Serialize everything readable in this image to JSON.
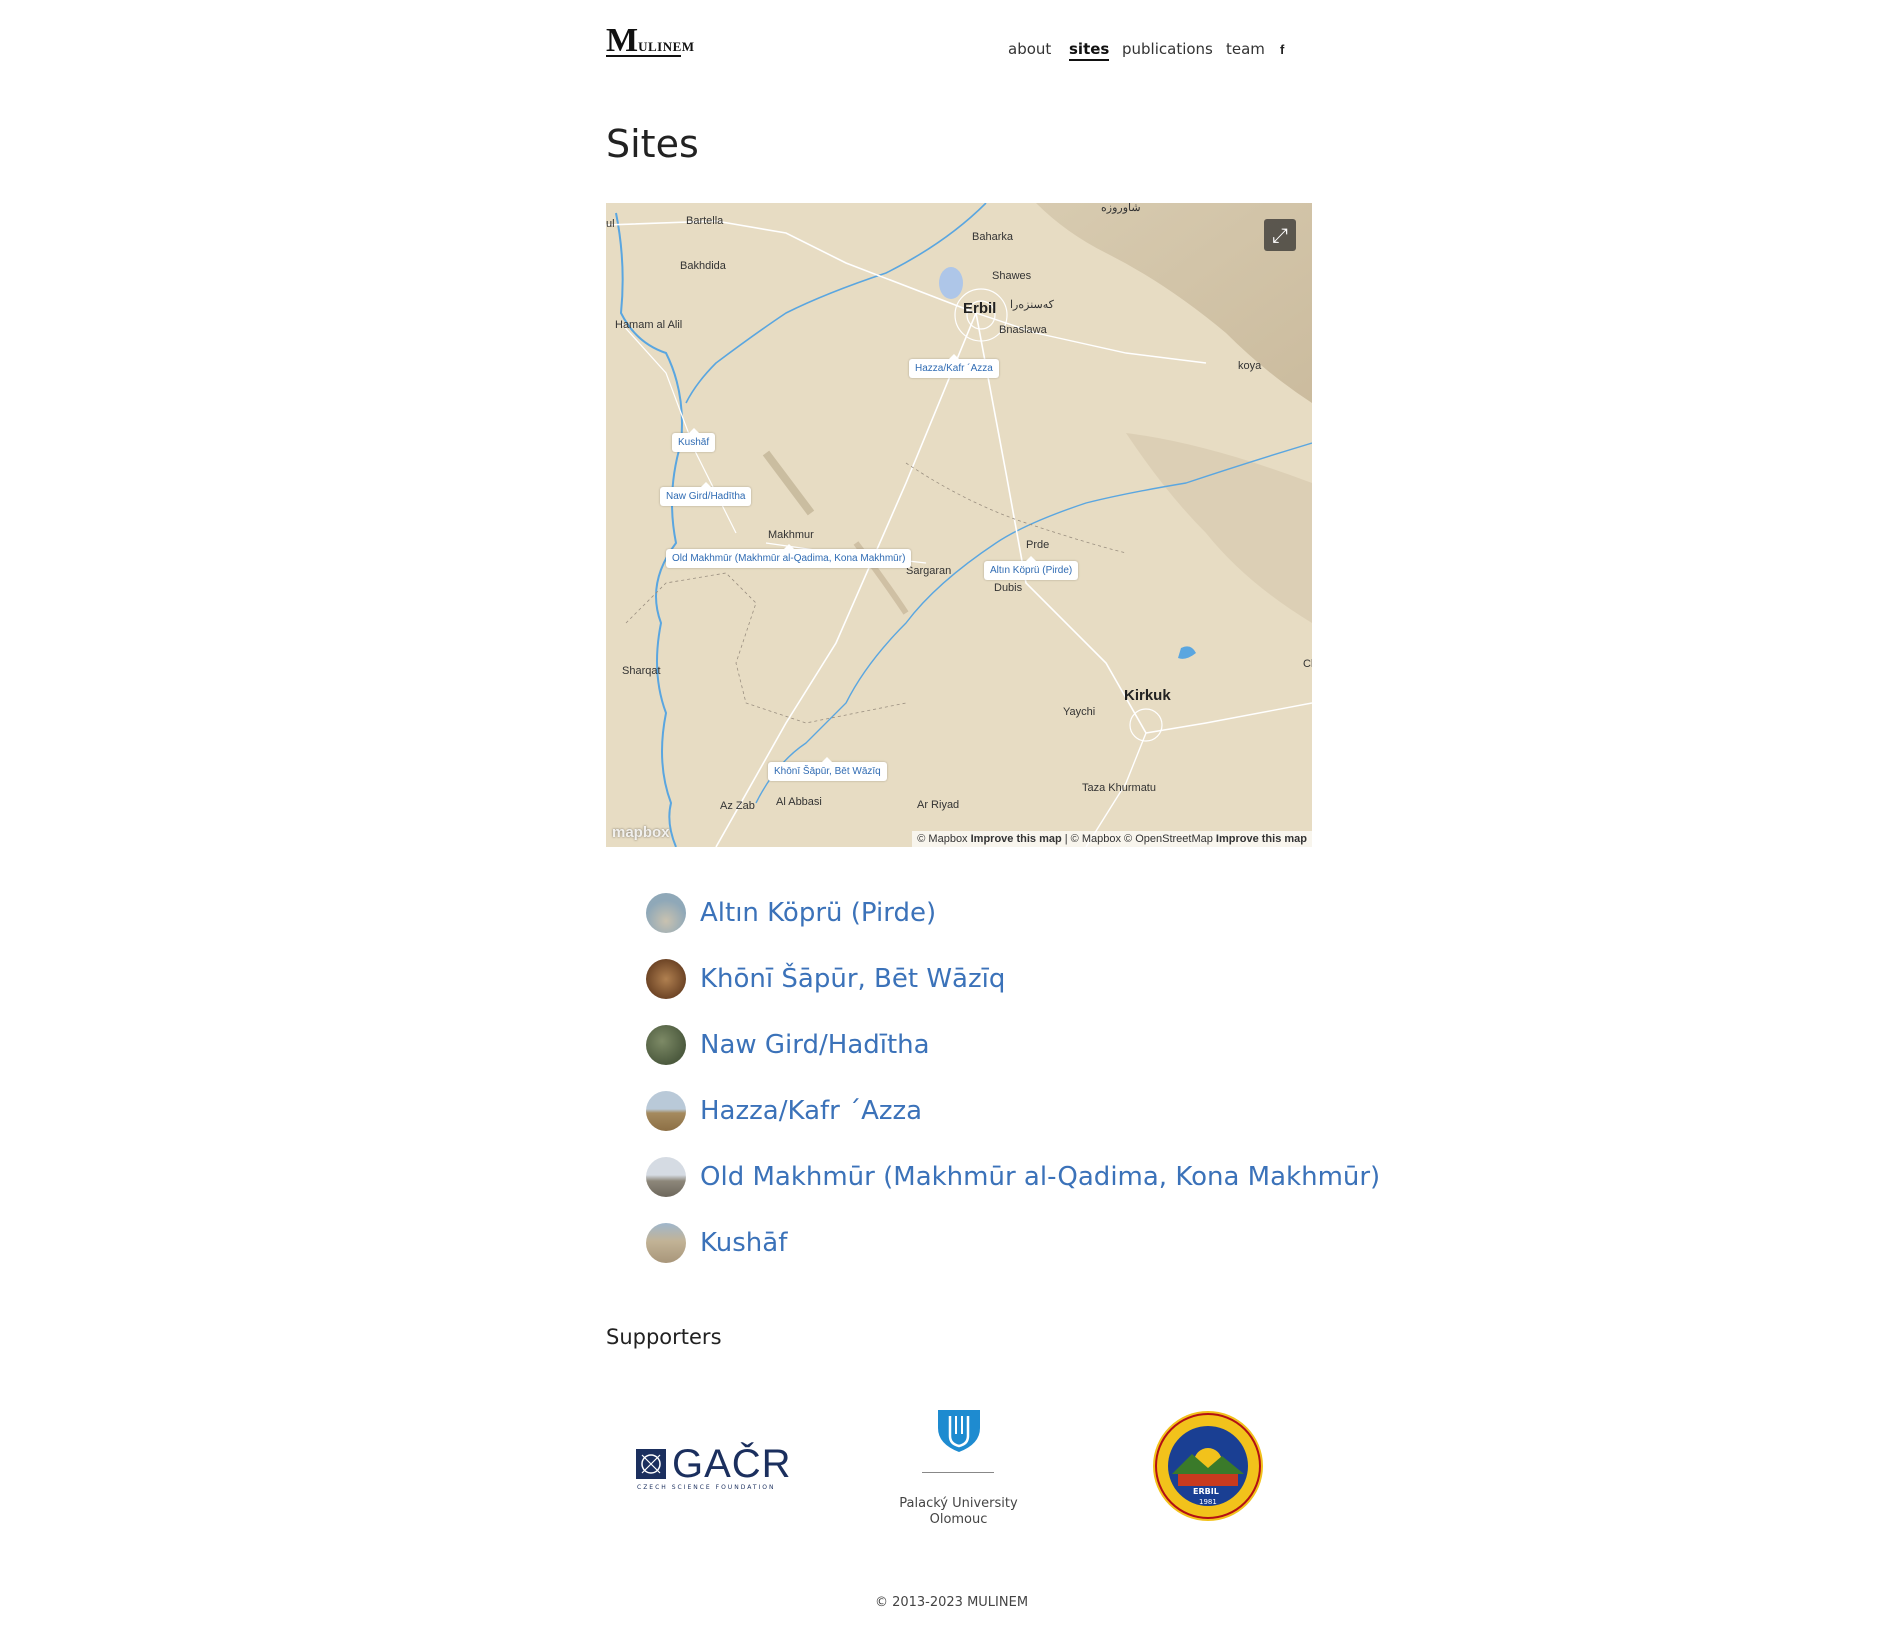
{
  "brand": {
    "logo_big": "M",
    "logo_small": "ULINEM"
  },
  "nav": {
    "items": [
      "about",
      "sites",
      "publications",
      "team"
    ],
    "active": "sites",
    "facebook": "f"
  },
  "page_title": "Sites",
  "map": {
    "place_labels": {
      "ul": "ul",
      "bartella": "Bartella",
      "baharka": "Baharka",
      "bakhdida": "Bakhdida",
      "shawes": "Shawes",
      "erbil": "Erbil",
      "erbil_kurdish": "کەسنزەرا",
      "bnaslawa": "Bnaslawa",
      "hamam_al_alil": "Hamam al Alil",
      "koya": "koya",
      "top_kurdish": "شاوروزه",
      "makhmur": "Makhmur",
      "prde": "Prde",
      "sargaran": "Sargaran",
      "dubis": "Dubis",
      "sharqat": "Sharqat",
      "kirkuk": "Kirkuk",
      "yaychi": "Yaychi",
      "cl": "Cl",
      "az_zab": "Az Zab",
      "al_abbasi": "Al Abbasi",
      "ar_riyad": "Ar Riyad",
      "taza_khurmatu": "Taza Khurmatu"
    },
    "site_markers": {
      "hazza": "Hazza/Kafr ´Azza",
      "kushaf": "Kushāf",
      "nawgird": "Naw Gird/Hadītha",
      "oldmakhmur": "Old Makhmūr (Makhmūr al-Qadima, Kona Makhmūr)",
      "altin": "Altın Köprü (Pirde)",
      "khoni": "Khōnī Šāpūr, Bēt Wāzīq"
    },
    "logo_text": "mapbox",
    "attribution_1": "© Mapbox",
    "improve_1": "Improve this map",
    "attribution_2": "| © Mapbox © OpenStreetMap",
    "improve_2": "Improve this map",
    "fullscreen_icon": "expand-icon"
  },
  "sites": [
    {
      "name": "Altın Köprü (Pirde)",
      "thumb_color": "#8fa8b8"
    },
    {
      "name": "Khōnī Šāpūr, Bēt Wāzīq",
      "thumb_color": "#8a5a35"
    },
    {
      "name": "Naw Gird/Hadītha",
      "thumb_color": "#5c6b4a"
    },
    {
      "name": "Hazza/Kafr ´Azza",
      "thumb_color": "#b79a6a"
    },
    {
      "name": "Old Makhmūr (Makhmūr al-Qadima, Kona Makhmūr)",
      "thumb_color": "#a7a49a"
    },
    {
      "name": "Kushāf",
      "thumb_color": "#b8a88a"
    }
  ],
  "supporters": {
    "heading": "Supporters",
    "gacr": {
      "text": "GAČR",
      "sub": "CZECH SCIENCE FOUNDATION"
    },
    "palacky": {
      "line1": "Palacký University",
      "line2": "Olomouc"
    },
    "salahaddin": {
      "label": "ERBIL",
      "year": "1981"
    }
  },
  "footer": "© 2013-2023 MULINEM",
  "colors": {
    "link": "#3b72b9",
    "map_bg": "#e6dac0",
    "water": "#5aa6e0"
  }
}
